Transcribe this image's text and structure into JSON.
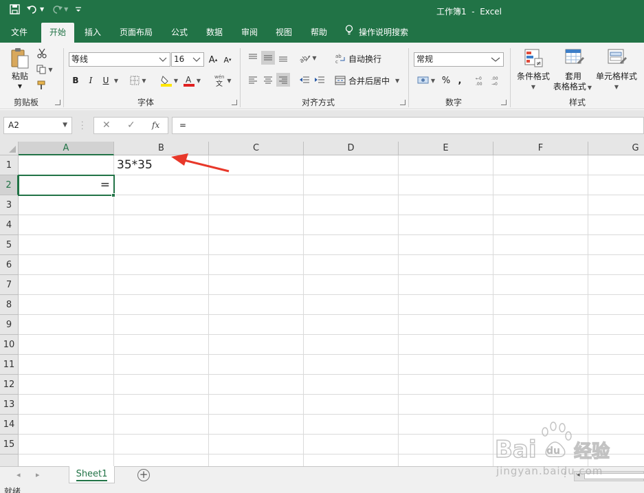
{
  "titlebar": {
    "title": "工作簿1  -  Excel",
    "accent_color": "#217346",
    "qat_icons": [
      "save-icon",
      "undo-icon",
      "redo-icon",
      "customize-qat-icon"
    ]
  },
  "menu_tabs": [
    "文件",
    "开始",
    "插入",
    "页面布局",
    "公式",
    "数据",
    "审阅",
    "视图",
    "帮助"
  ],
  "active_tab": "开始",
  "tell_me": "操作说明搜索",
  "ribbon": {
    "clipboard": {
      "paste": "粘贴",
      "label": "剪贴板"
    },
    "font": {
      "font_name": "等线",
      "font_size": "16",
      "bold": "B",
      "italic": "I",
      "underline": "U",
      "label": "字体"
    },
    "alignment": {
      "wrap_text": "自动换行",
      "merge_center": "合并后居中",
      "label": "对齐方式"
    },
    "number": {
      "format": "常规",
      "label": "数字"
    },
    "styles": {
      "conditional": "条件格式",
      "table_1": "套用",
      "table_2": "表格格式",
      "cell_styles": "单元格样式",
      "label": "样式"
    }
  },
  "formula_bar": {
    "name_box": "A2",
    "formula": "="
  },
  "grid": {
    "columns": [
      "A",
      "B",
      "C",
      "D",
      "E",
      "F",
      "G"
    ],
    "rows": [
      "1",
      "2",
      "3",
      "4",
      "5",
      "6",
      "7",
      "8",
      "9",
      "10",
      "11",
      "12",
      "13",
      "14",
      "15"
    ],
    "selected_cell": "A2",
    "cells": {
      "B1": "35*35",
      "A2": "="
    }
  },
  "sheets": [
    "Sheet1"
  ],
  "status": "就绪",
  "watermark": {
    "brand": "Bai",
    "brand2": "du",
    "cn": "经验",
    "url": "jingyan.baidu.com"
  }
}
